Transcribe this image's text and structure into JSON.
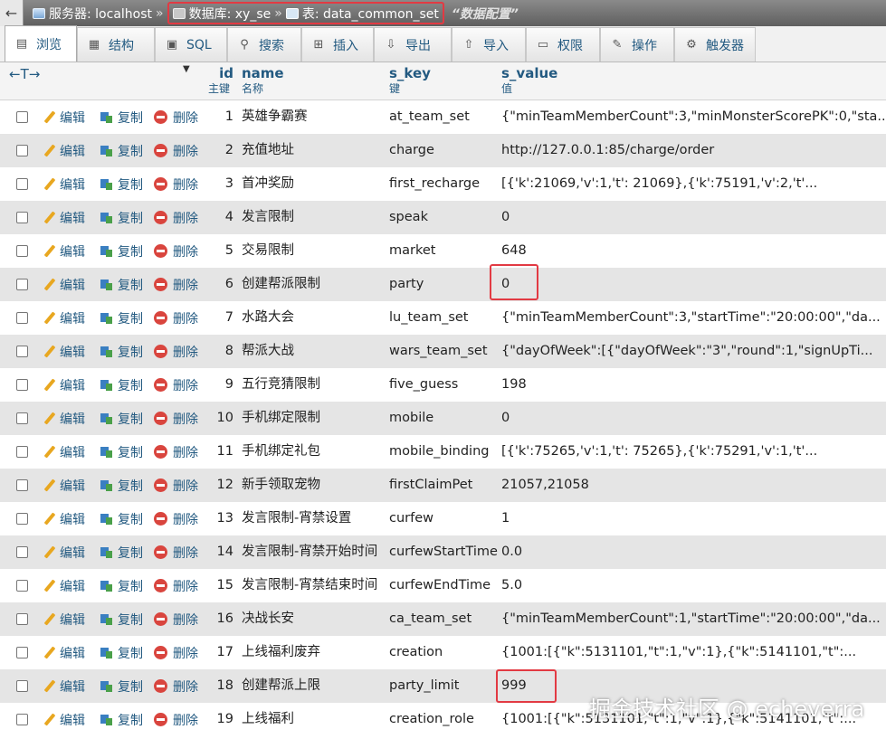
{
  "breadcrumb": {
    "back": "←",
    "server": "服务器: localhost",
    "sep": "»",
    "database": "数据库: xy_se",
    "table": "表: data_common_set",
    "comment": "“数据配置”"
  },
  "tabs": [
    {
      "label": "浏览",
      "icon": "browse-icon"
    },
    {
      "label": "结构",
      "icon": "structure-icon"
    },
    {
      "label": "SQL",
      "icon": "sql-icon"
    },
    {
      "label": "搜索",
      "icon": "search-icon"
    },
    {
      "label": "插入",
      "icon": "insert-icon"
    },
    {
      "label": "导出",
      "icon": "export-icon"
    },
    {
      "label": "导入",
      "icon": "import-icon"
    },
    {
      "label": "权限",
      "icon": "privileges-icon"
    },
    {
      "label": "操作",
      "icon": "operations-icon"
    },
    {
      "label": "触发器",
      "icon": "triggers-icon"
    }
  ],
  "header": {
    "arrows": "←T→",
    "sort": "▼",
    "id": {
      "name": "id",
      "comment": "主键"
    },
    "name": {
      "name": "name",
      "comment": "名称"
    },
    "s_key": {
      "name": "s_key",
      "comment": "键"
    },
    "s_value": {
      "name": "s_value",
      "comment": "值"
    }
  },
  "actions": {
    "edit": "编辑",
    "copy": "复制",
    "delete": "删除"
  },
  "rows": [
    {
      "id": "1",
      "name": "英雄争霸赛",
      "key": "at_team_set",
      "value": "{\"minTeamMemberCount\":3,\"minMonsterScorePK\":0,\"sta..."
    },
    {
      "id": "2",
      "name": "充值地址",
      "key": "charge",
      "value": "http://127.0.0.1:85/charge/order"
    },
    {
      "id": "3",
      "name": "首冲奖励",
      "key": "first_recharge",
      "value": "[{'k':21069,'v':1,'t': 21069},{'k':75191,'v':2,'t'..."
    },
    {
      "id": "4",
      "name": "发言限制",
      "key": "speak",
      "value": "0"
    },
    {
      "id": "5",
      "name": "交易限制",
      "key": "market",
      "value": "648"
    },
    {
      "id": "6",
      "name": "创建帮派限制",
      "key": "party",
      "value": "0"
    },
    {
      "id": "7",
      "name": "水路大会",
      "key": "lu_team_set",
      "value": "{\"minTeamMemberCount\":3,\"startTime\":\"20:00:00\",\"da..."
    },
    {
      "id": "8",
      "name": "帮派大战",
      "key": "wars_team_set",
      "value": "{\"dayOfWeek\":[{\"dayOfWeek\":\"3\",\"round\":1,\"signUpTi..."
    },
    {
      "id": "9",
      "name": "五行竞猜限制",
      "key": "five_guess",
      "value": "198"
    },
    {
      "id": "10",
      "name": "手机绑定限制",
      "key": "mobile",
      "value": "0"
    },
    {
      "id": "11",
      "name": "手机绑定礼包",
      "key": "mobile_binding",
      "value": "[{'k':75265,'v':1,'t': 75265},{'k':75291,'v':1,'t'..."
    },
    {
      "id": "12",
      "name": "新手领取宠物",
      "key": "firstClaimPet",
      "value": "21057,21058"
    },
    {
      "id": "13",
      "name": "发言限制-宵禁设置",
      "key": "curfew",
      "value": "1"
    },
    {
      "id": "14",
      "name": "发言限制-宵禁开始时间",
      "key": "curfewStartTime",
      "value": "0.0"
    },
    {
      "id": "15",
      "name": "发言限制-宵禁结束时间",
      "key": "curfewEndTime",
      "value": "5.0"
    },
    {
      "id": "16",
      "name": "决战长安",
      "key": "ca_team_set",
      "value": "{\"minTeamMemberCount\":1,\"startTime\":\"20:00:00\",\"da..."
    },
    {
      "id": "17",
      "name": "上线福利废弃",
      "key": "creation",
      "value": "{1001:[{\"k\":5131101,\"t\":1,\"v\":1},{\"k\":5141101,\"t\":..."
    },
    {
      "id": "18",
      "name": "创建帮派上限",
      "key": "party_limit",
      "value": "999"
    },
    {
      "id": "19",
      "name": "上线福利",
      "key": "creation_role",
      "value": "{1001:[{\"k\":5131101,\"t\":1,\"v\":1},{\"k\":5141101,\"t\":..."
    }
  ],
  "watermark": "掘金技术社区 @ echeverra",
  "colors": {
    "accent": "#235a81",
    "highlight": "#e23a43",
    "row_alt": "#e5e5e5"
  }
}
